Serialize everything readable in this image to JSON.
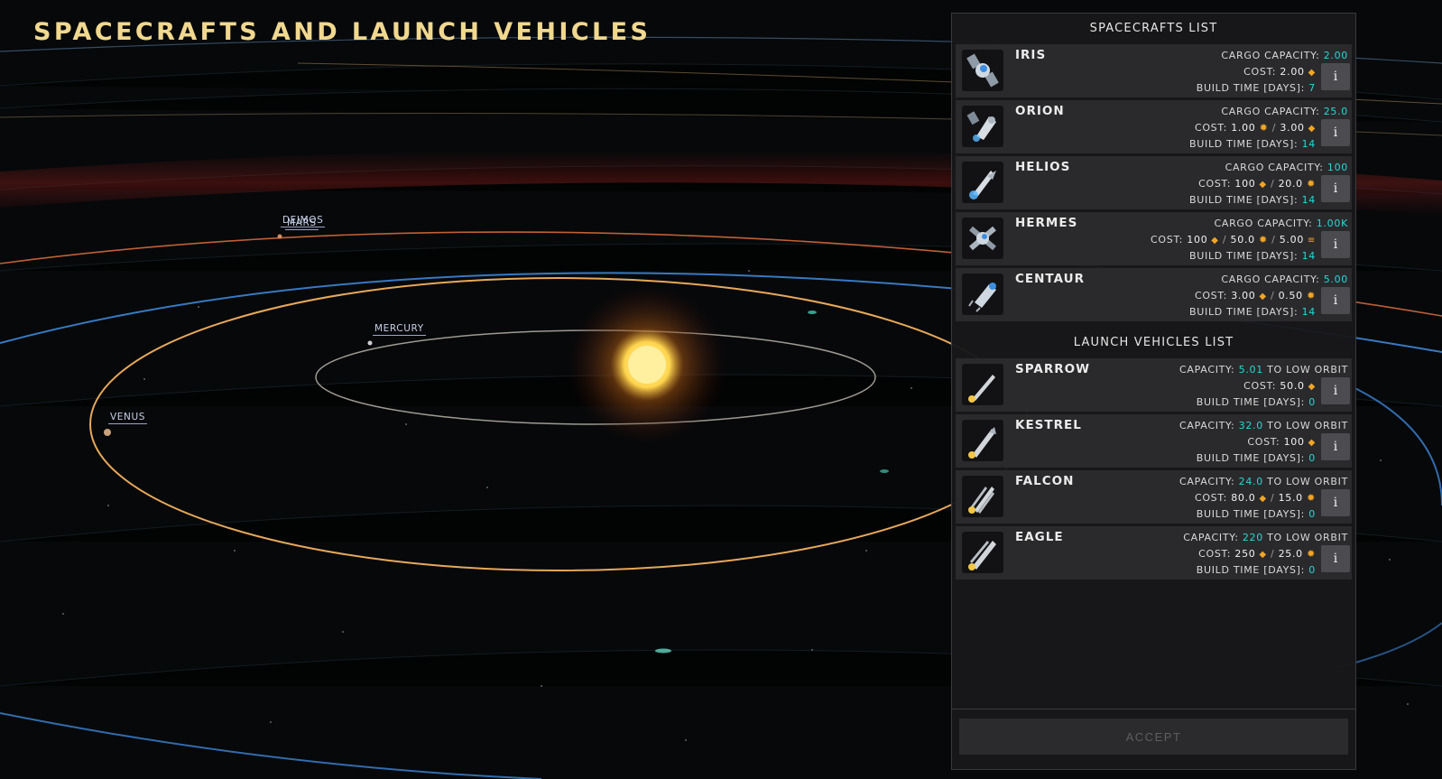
{
  "title": "SPACECRAFTS AND LAUNCH VEHICLES",
  "map": {
    "planets": [
      {
        "key": "deimos",
        "label": "DEIMOS"
      },
      {
        "key": "mars",
        "label": "MARS"
      },
      {
        "key": "mercury",
        "label": "MERCURY"
      },
      {
        "key": "venus",
        "label": "VENUS"
      }
    ]
  },
  "spacecrafts": {
    "header": "SPACECRAFTS LIST",
    "items": [
      {
        "name": "IRIS",
        "icon": "satellite-icon",
        "capacity_label": "CARGO CAPACITY:",
        "capacity": "2.00",
        "cost_label": "COST:",
        "cost": [
          {
            "v": "2.00",
            "r": "diamond"
          }
        ],
        "build_label": "BUILD TIME [DAYS]:",
        "build": "7"
      },
      {
        "name": "ORION",
        "icon": "capsule-icon",
        "capacity_label": "CARGO CAPACITY:",
        "capacity": "25.0",
        "cost_label": "COST:",
        "cost": [
          {
            "v": "1.00",
            "r": "gear"
          },
          {
            "v": "3.00",
            "r": "diamond"
          }
        ],
        "build_label": "BUILD TIME [DAYS]:",
        "build": "14"
      },
      {
        "name": "HELIOS",
        "icon": "shuttle-icon",
        "capacity_label": "CARGO CAPACITY:",
        "capacity": "100",
        "cost_label": "COST:",
        "cost": [
          {
            "v": "100",
            "r": "diamond"
          },
          {
            "v": "20.0",
            "r": "gear"
          }
        ],
        "build_label": "BUILD TIME [DAYS]:",
        "build": "14"
      },
      {
        "name": "HERMES",
        "icon": "station-icon",
        "capacity_label": "CARGO CAPACITY:",
        "capacity": "1.00K",
        "cost_label": "COST:",
        "cost": [
          {
            "v": "100",
            "r": "diamond"
          },
          {
            "v": "50.0",
            "r": "gear"
          },
          {
            "v": "5.00",
            "r": "bars"
          }
        ],
        "build_label": "BUILD TIME [DAYS]:",
        "build": "14"
      },
      {
        "name": "CENTAUR",
        "icon": "lander-icon",
        "capacity_label": "CARGO CAPACITY:",
        "capacity": "5.00",
        "cost_label": "COST:",
        "cost": [
          {
            "v": "3.00",
            "r": "diamond"
          },
          {
            "v": "0.50",
            "r": "gear"
          }
        ],
        "build_label": "BUILD TIME [DAYS]:",
        "build": "14"
      }
    ]
  },
  "launch_vehicles": {
    "header": "LAUNCH VEHICLES LIST",
    "items": [
      {
        "name": "SPARROW",
        "icon": "rocket-small-icon",
        "capacity_label": "CAPACITY:",
        "capacity": "5.01",
        "capacity_suffix": "TO LOW ORBIT",
        "cost_label": "COST:",
        "cost": [
          {
            "v": "50.0",
            "r": "diamond"
          }
        ],
        "build_label": "BUILD TIME [DAYS]:",
        "build": "0"
      },
      {
        "name": "KESTREL",
        "icon": "rocket-medium-icon",
        "capacity_label": "CAPACITY:",
        "capacity": "32.0",
        "capacity_suffix": "TO LOW ORBIT",
        "cost_label": "COST:",
        "cost": [
          {
            "v": "100",
            "r": "diamond"
          }
        ],
        "build_label": "BUILD TIME [DAYS]:",
        "build": "0"
      },
      {
        "name": "FALCON",
        "icon": "rocket-heavy-icon",
        "capacity_label": "CAPACITY:",
        "capacity": "24.0",
        "capacity_suffix": "TO LOW ORBIT",
        "cost_label": "COST:",
        "cost": [
          {
            "v": "80.0",
            "r": "diamond"
          },
          {
            "v": "15.0",
            "r": "gear"
          }
        ],
        "build_label": "BUILD TIME [DAYS]:",
        "build": "0"
      },
      {
        "name": "EAGLE",
        "icon": "rocket-super-heavy-icon",
        "capacity_label": "CAPACITY:",
        "capacity": "220",
        "capacity_suffix": "TO LOW ORBIT",
        "cost_label": "COST:",
        "cost": [
          {
            "v": "250",
            "r": "diamond"
          },
          {
            "v": "25.0",
            "r": "gear"
          }
        ],
        "build_label": "BUILD TIME [DAYS]:",
        "build": "0"
      }
    ]
  },
  "info_label": "i",
  "accept_label": "ACCEPT",
  "colors": {
    "title": "#f1d88f",
    "value_cyan": "#28d8d6",
    "resource_orange": "#f3a524",
    "orbit_gold": "#e7a85a",
    "orbit_blue": "#3d86d6",
    "orbit_mars": "#d46a3a",
    "sun": "#fff0a0"
  }
}
